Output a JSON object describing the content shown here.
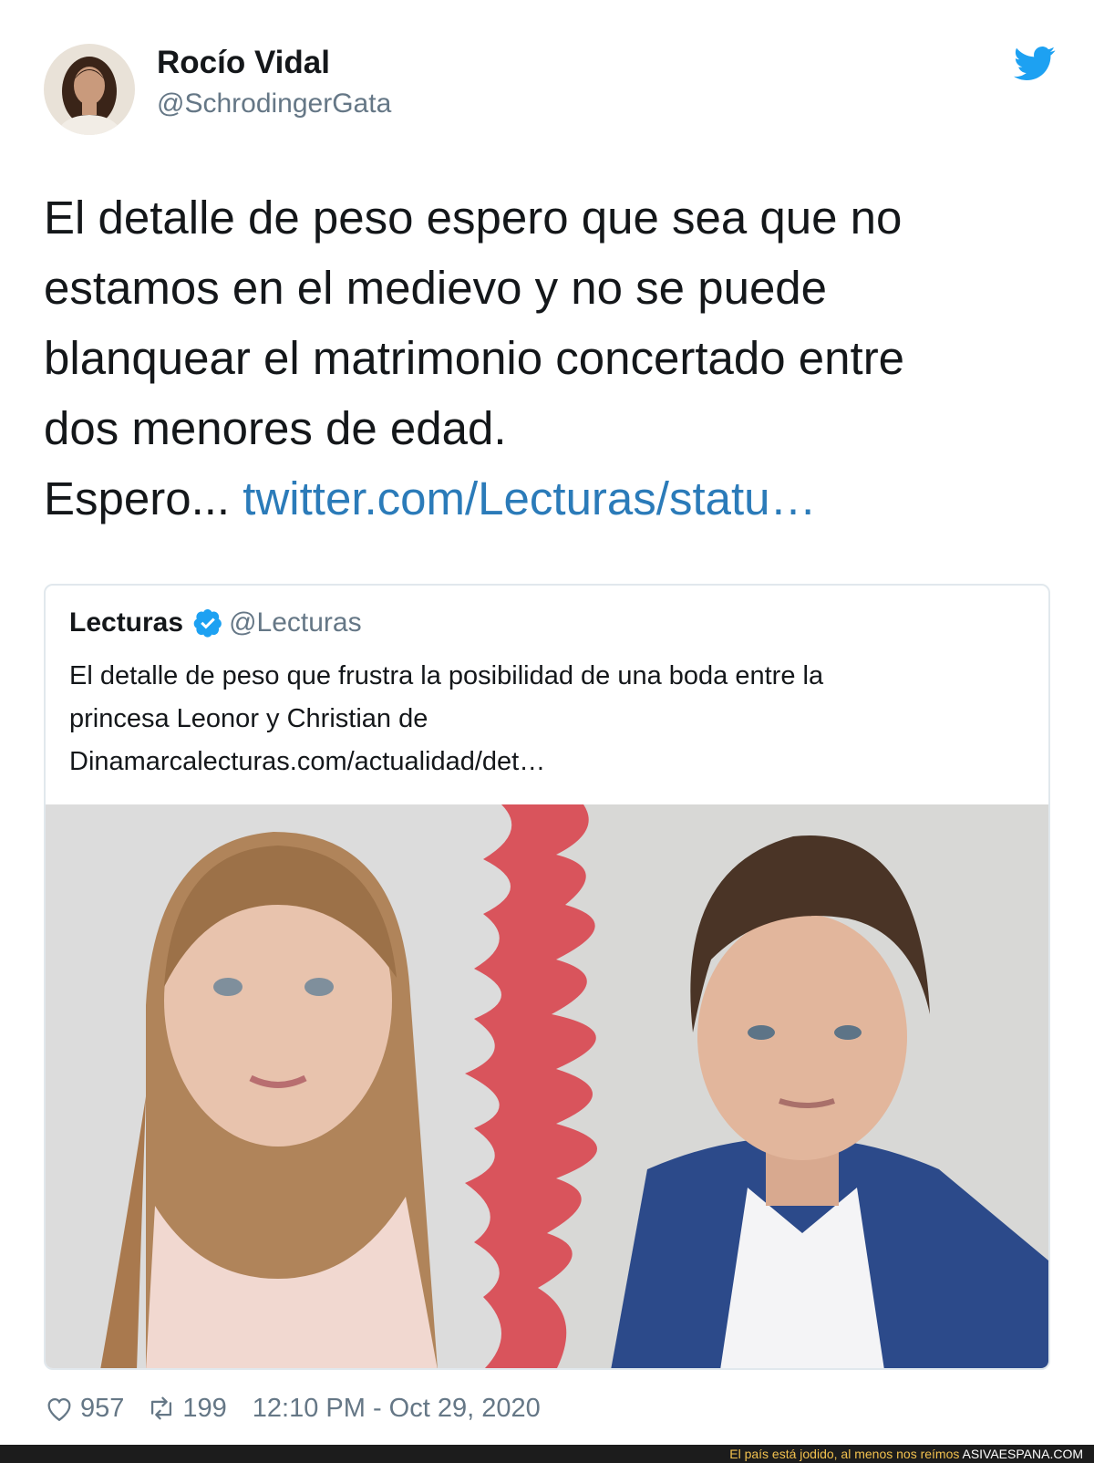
{
  "tweet": {
    "author_name": "Rocío Vidal",
    "author_handle": "@SchrodingerGata",
    "text_lines": [
      "El detalle de peso espero que sea que no",
      "estamos en el medievo y no se puede",
      "blanquear el matrimonio concertado entre",
      "dos menores de edad."
    ],
    "text_last_prefix": "Espero... ",
    "link": "twitter.com/Lecturas/statu…",
    "likes": "957",
    "retweets": "199",
    "timestamp": "12:10 PM - Oct 29, 2020"
  },
  "quoted": {
    "name": "Lecturas",
    "handle": "@Lecturas",
    "text_lines": [
      "El detalle de peso que frustra la posibilidad de una boda entre la",
      "princesa Leonor y Christian de",
      "Dinamarcalecturas.com/actualidad/det…"
    ]
  },
  "icons": {
    "brand": "twitter-bird-icon",
    "verified": "verified-badge-icon",
    "like": "heart-icon",
    "retweet": "retweet-icon"
  },
  "colors": {
    "link": "#2b7bb9",
    "twitter_blue": "#1da1f2",
    "secondary_text": "#657786",
    "tear_red": "#d9545c"
  },
  "footer": {
    "tagline": "El país está jodido, al menos nos reímos ",
    "site": "ASIVAESPANA.COM"
  }
}
